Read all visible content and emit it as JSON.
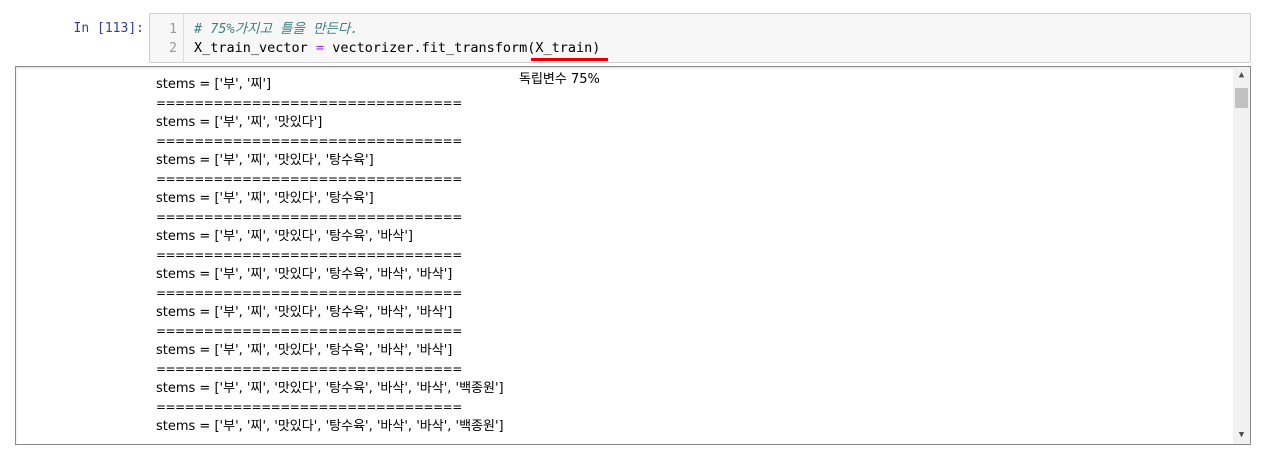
{
  "cell": {
    "prompt": "In [113]:",
    "line_numbers": [
      "1",
      "2"
    ],
    "code_line1": "# 75%가지고 틀을 만든다.",
    "code_line2_var": "X_train_vector ",
    "code_line2_op": "=",
    "code_line2_rest": " vectorizer.fit_transform(X_train)"
  },
  "output": {
    "annotation": "독립변수 75%",
    "separator": "================================",
    "lines": [
      "stems = ['부', '찌']",
      "stems = ['부', '찌', '맛있다']",
      "stems = ['부', '찌', '맛있다', '탕수육']",
      "stems = ['부', '찌', '맛있다', '탕수육']",
      "stems = ['부', '찌', '맛있다', '탕수육', '바삭']",
      "stems = ['부', '찌', '맛있다', '탕수육', '바삭', '바삭']",
      "stems = ['부', '찌', '맛있다', '탕수육', '바삭', '바삭']",
      "stems = ['부', '찌', '맛있다', '탕수육', '바삭', '바삭']",
      "stems = ['부', '찌', '맛있다', '탕수육', '바삭', '바삭', '백종원']",
      "stems = ['부', '찌', '맛있다', '탕수육', '바삭', '바삭', '백종원']"
    ]
  },
  "scrollbar": {
    "up_glyph": "▲",
    "down_glyph": "▼"
  },
  "colors": {
    "prompt": "#303f9f",
    "comment": "#408080",
    "operator": "#aa22ff",
    "underline": "#e00000"
  }
}
